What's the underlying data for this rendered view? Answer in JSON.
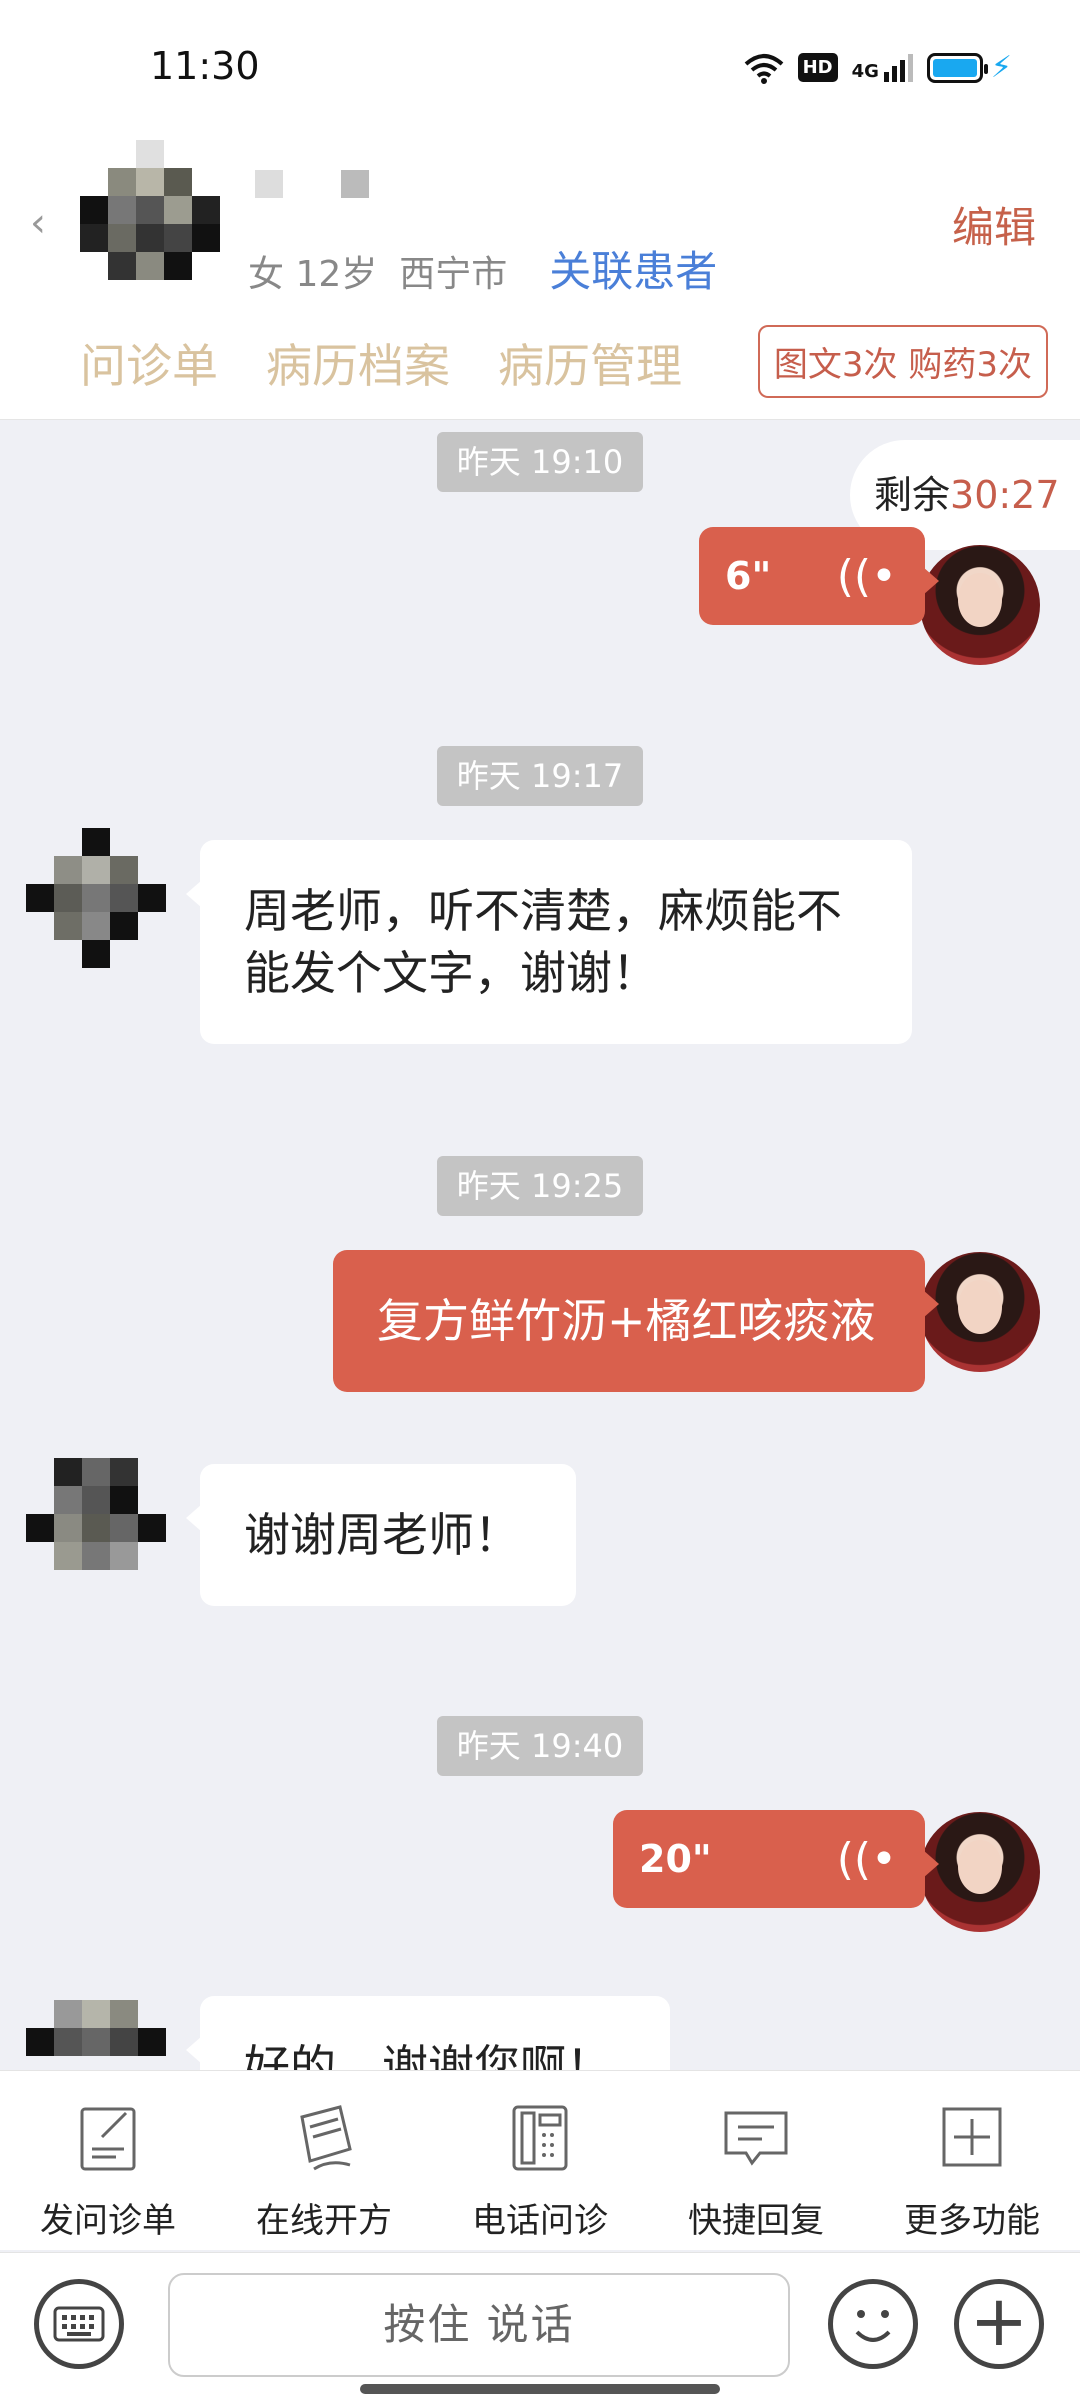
{
  "status_bar": {
    "time": "11:30",
    "hd": "HD",
    "network": "4G"
  },
  "header": {
    "patient_gender_age": "女 12岁",
    "patient_city": "西宁市",
    "link_patient": "关联患者",
    "edit": "编辑",
    "tabs": [
      "问诊单",
      "病历档案",
      "病历管理"
    ],
    "quota": "图文3次 购药3次"
  },
  "chat": {
    "remaining_label": "剩余",
    "remaining_time": "30:27",
    "messages": [
      {
        "kind": "time",
        "text": "昨天 19:10"
      },
      {
        "kind": "voice-out",
        "duration": "6\""
      },
      {
        "kind": "time",
        "text": "昨天 19:17"
      },
      {
        "kind": "text-in",
        "text": "周老师，听不清楚，麻烦能不能发个文字，谢谢！"
      },
      {
        "kind": "time",
        "text": "昨天 19:25"
      },
      {
        "kind": "text-out",
        "text": "复方鲜竹沥+橘红咳痰液"
      },
      {
        "kind": "text-in",
        "text": "谢谢周老师！"
      },
      {
        "kind": "time",
        "text": "昨天 19:40"
      },
      {
        "kind": "voice-out",
        "duration": "20\""
      },
      {
        "kind": "text-in",
        "text": "好的，谢谢您啊！"
      }
    ]
  },
  "functions": [
    {
      "label": "发问诊单",
      "icon": "form-edit-icon"
    },
    {
      "label": "在线开方",
      "icon": "prescription-icon"
    },
    {
      "label": "电话问诊",
      "icon": "phone-icon"
    },
    {
      "label": "快捷回复",
      "icon": "quick-reply-icon"
    },
    {
      "label": "更多功能",
      "icon": "more-plus-icon"
    }
  ],
  "input_bar": {
    "talk_label": "按住 说话"
  },
  "colors": {
    "accent": "#d9604d",
    "link": "#4a7fd8",
    "tab": "#d9c39f"
  }
}
